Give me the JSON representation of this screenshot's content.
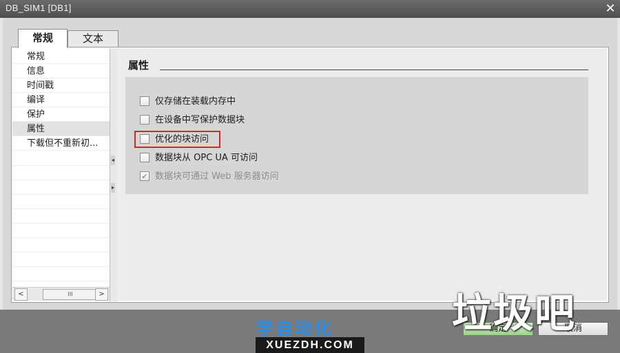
{
  "window": {
    "title": "DB_SIM1 [DB1]",
    "close_glyph": "✕"
  },
  "tabs": [
    {
      "label": "常规",
      "active": true
    },
    {
      "label": "文本",
      "active": false
    }
  ],
  "nav": {
    "items": [
      {
        "label": "常规",
        "selected": false
      },
      {
        "label": "信息",
        "selected": false
      },
      {
        "label": "时间戳",
        "selected": false
      },
      {
        "label": "编译",
        "selected": false
      },
      {
        "label": "保护",
        "selected": false
      },
      {
        "label": "属性",
        "selected": true
      },
      {
        "label": "下载但不重新初...",
        "selected": false
      }
    ],
    "scroll_left": "<",
    "scroll_right": ">",
    "scroll_thumb": "III"
  },
  "section": {
    "title": "属性"
  },
  "options": [
    {
      "label": "仅存储在装载内存中",
      "checked": false,
      "disabled": false
    },
    {
      "label": "在设备中写保护数据块",
      "checked": false,
      "disabled": false
    },
    {
      "label": "优化的块访问",
      "checked": false,
      "disabled": false
    },
    {
      "label": "数据块从 OPC UA 可访问",
      "checked": false,
      "disabled": false
    },
    {
      "label": "数据块可通过 Web 服务器访问",
      "checked": true,
      "disabled": true
    }
  ],
  "check_glyph": "✔",
  "buttons": {
    "ok": "确定",
    "cancel": "取消"
  },
  "watermarks": {
    "left_cn": "学自动化",
    "left_url": "XUEZDH.COM",
    "right_cn": "垃圾吧"
  },
  "colors": {
    "titlebar": "#5c5c5c",
    "highlight": "#dd2222",
    "ok_button": "#a9d69a",
    "watermark_blue": "#2d8ee8"
  }
}
